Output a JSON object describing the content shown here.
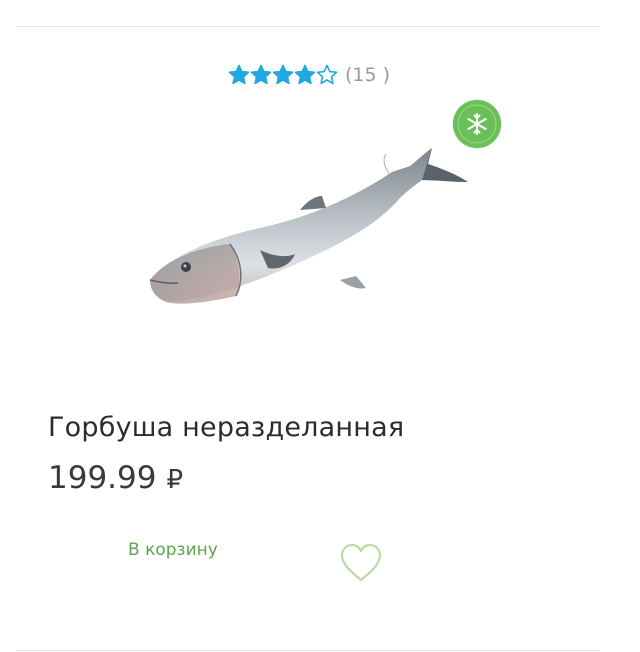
{
  "product": {
    "title": "Горбуша неразделанная",
    "price": "199.99",
    "currency": "₽",
    "rating": {
      "stars_filled": 4,
      "stars_total": 5,
      "count_text": "(15 )"
    },
    "badge_icon": "snowflake-icon",
    "image_icon": "fish-image"
  },
  "actions": {
    "add_to_cart_label": "В корзину",
    "favorite_icon": "heart-outline-icon"
  },
  "colors": {
    "star": "#1fa9e0",
    "accent_green": "#6bbf59",
    "cart_text": "#5ba54b",
    "heart": "#b9dca7"
  }
}
